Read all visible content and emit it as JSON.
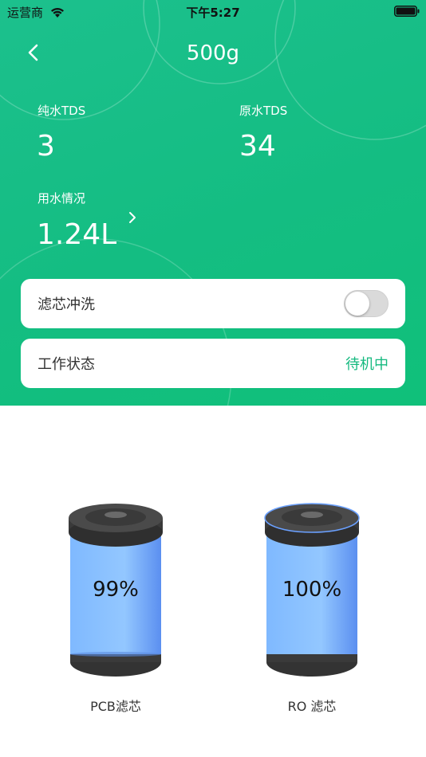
{
  "status_bar": {
    "carrier": "运营商",
    "time": "下午5:27"
  },
  "header": {
    "title": "500g"
  },
  "stats": {
    "pure_tds_label": "纯水TDS",
    "pure_tds_value": "3",
    "raw_tds_label": "原水TDS",
    "raw_tds_value": "34",
    "usage_label": "用水情况",
    "usage_value": "1.24L"
  },
  "controls": {
    "flush_label": "滤芯冲洗",
    "flush_on": false,
    "work_status_label": "工作状态",
    "work_status_value": "待机中"
  },
  "filters": [
    {
      "name": "PCB滤芯",
      "percent_text": "99%",
      "percent": 99
    },
    {
      "name": "RO 滤芯",
      "percent_text": "100%",
      "percent": 100
    }
  ],
  "colors": {
    "accent": "#14bd82",
    "status_value": "#14b97f",
    "filter_body": "#8fc3ff",
    "filter_cap": "#3c3c3c"
  }
}
